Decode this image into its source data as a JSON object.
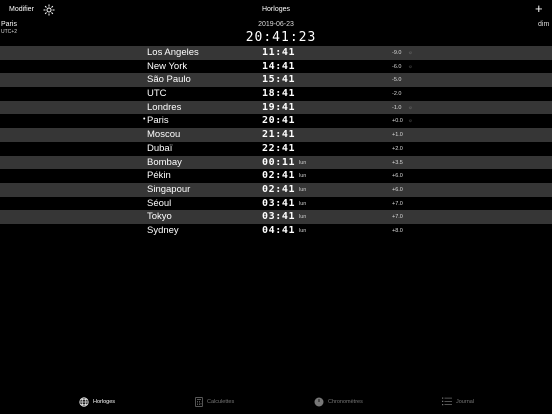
{
  "nav": {
    "edit_label": "Modifier",
    "title": "Horloges",
    "add_label": "+",
    "settings_icon": "gear-icon"
  },
  "home": {
    "city": "Paris",
    "tz": "UTC+2",
    "date": "2019-06-23",
    "time": "20:41:23",
    "day_right": "dim"
  },
  "rows": [
    {
      "city": "Los Angeles",
      "time": "11:41",
      "suffix": "",
      "offset": "-9.0",
      "dst": "☼",
      "current": false
    },
    {
      "city": "New York",
      "time": "14:41",
      "suffix": "",
      "offset": "-6.0",
      "dst": "☼",
      "current": false
    },
    {
      "city": "São Paulo",
      "time": "15:41",
      "suffix": "",
      "offset": "-5.0",
      "dst": "",
      "current": false
    },
    {
      "city": "UTC",
      "time": "18:41",
      "suffix": "",
      "offset": "-2.0",
      "dst": "",
      "current": false
    },
    {
      "city": "Londres",
      "time": "19:41",
      "suffix": "",
      "offset": "-1.0",
      "dst": "☼",
      "current": false
    },
    {
      "city": "Paris",
      "time": "20:41",
      "suffix": "",
      "offset": "+0.0",
      "dst": "☼",
      "current": true
    },
    {
      "city": "Moscou",
      "time": "21:41",
      "suffix": "",
      "offset": "+1.0",
      "dst": "",
      "current": false
    },
    {
      "city": "Dubaï",
      "time": "22:41",
      "suffix": "",
      "offset": "+2.0",
      "dst": "",
      "current": false
    },
    {
      "city": "Bombay",
      "time": "00:11",
      "suffix": "lun",
      "offset": "+3.5",
      "dst": "",
      "current": false
    },
    {
      "city": "Pékin",
      "time": "02:41",
      "suffix": "lun",
      "offset": "+6.0",
      "dst": "",
      "current": false
    },
    {
      "city": "Singapour",
      "time": "02:41",
      "suffix": "lun",
      "offset": "+6.0",
      "dst": "",
      "current": false
    },
    {
      "city": "Séoul",
      "time": "03:41",
      "suffix": "lun",
      "offset": "+7.0",
      "dst": "",
      "current": false
    },
    {
      "city": "Tokyo",
      "time": "03:41",
      "suffix": "lun",
      "offset": "+7.0",
      "dst": "",
      "current": false
    },
    {
      "city": "Sydney",
      "time": "04:41",
      "suffix": "lun",
      "offset": "+8.0",
      "dst": "",
      "current": false
    }
  ],
  "tabs": [
    {
      "label": "Horloges",
      "icon": "globe-icon",
      "active": true
    },
    {
      "label": "Calculettes",
      "icon": "calculator-icon",
      "active": false
    },
    {
      "label": "Chronomètres",
      "icon": "stopwatch-icon",
      "active": false
    },
    {
      "label": "Journal",
      "icon": "list-icon",
      "active": false
    }
  ]
}
